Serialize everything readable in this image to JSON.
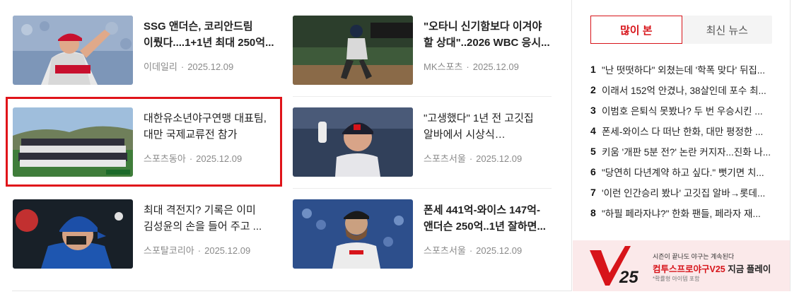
{
  "articles": [
    {
      "title": "SSG 앤더슨, 코리안드림 이뤘다....1+1년 최대 250억...",
      "source": "이데일리",
      "date": "2025.12.09",
      "bold": true
    },
    {
      "title": "\"오타니 신기함보다 이겨야 할 상대\"..2026 WBC 응시...",
      "source": "MK스포츠",
      "date": "2025.12.09",
      "bold": true
    },
    {
      "title": "대한유소년야구연맹 대표팀, 대만 국제교류전 참가",
      "source": "스포츠동아",
      "date": "2025.12.09",
      "bold": false
    },
    {
      "title": "\"고생했다\" 1년 전 고깃집 알바에서 시상식 주인공으로...",
      "source": "스포츠서울",
      "date": "2025.12.09",
      "bold": false
    },
    {
      "title": "최대 격전지? 기록은 이미 김성윤의 손을 들어 주고 ...",
      "source": "스포탈코리아",
      "date": "2025.12.09",
      "bold": false
    },
    {
      "title": "폰세 441억-와이스 147억-앤더슨 250억..1년 잘하면...",
      "source": "스포츠서울",
      "date": "2025.12.09",
      "bold": false
    }
  ],
  "sidebar": {
    "tabs": [
      {
        "label": "많이 본",
        "active": true
      },
      {
        "label": "최신 뉴스",
        "active": false
      }
    ],
    "ranking": [
      {
        "rank": "1",
        "text": "\"난 떳떳하다\" 외쳤는데 '학폭 맞다' 뒤집..."
      },
      {
        "rank": "2",
        "text": "이래서 152억 안겼나, 38살인데 포수 최..."
      },
      {
        "rank": "3",
        "text": "이범호 은퇴식 못봤나? 두 번 우승시킨 ..."
      },
      {
        "rank": "4",
        "text": "폰세-와이스 다 떠난 한화, 대만 평정한 ..."
      },
      {
        "rank": "5",
        "text": "키움 '개판 5분 전?' 논란 커지자...진화 나..."
      },
      {
        "rank": "6",
        "text": "\"당연히 다년계약 하고 싶다.\" 뻣기면 치..."
      },
      {
        "rank": "7",
        "text": "'이런 인간승리 봤나' 고깃집 알바→롯데..."
      },
      {
        "rank": "8",
        "text": "\"하필 페라자냐?\" 한화 팬들, 페라자 재..."
      }
    ],
    "ad": {
      "logo_text": "25",
      "small_text": "시즌이 끝나도 야구는 계속된다",
      "brand_text": "컴투스프로야구V25",
      "cta_text": " 지금 플레이",
      "note_text": "*확률형 아이템 포함"
    }
  },
  "colors": {
    "accent": "#d7141a",
    "highlight": "#e0141a",
    "meta": "#8a8a8a"
  }
}
